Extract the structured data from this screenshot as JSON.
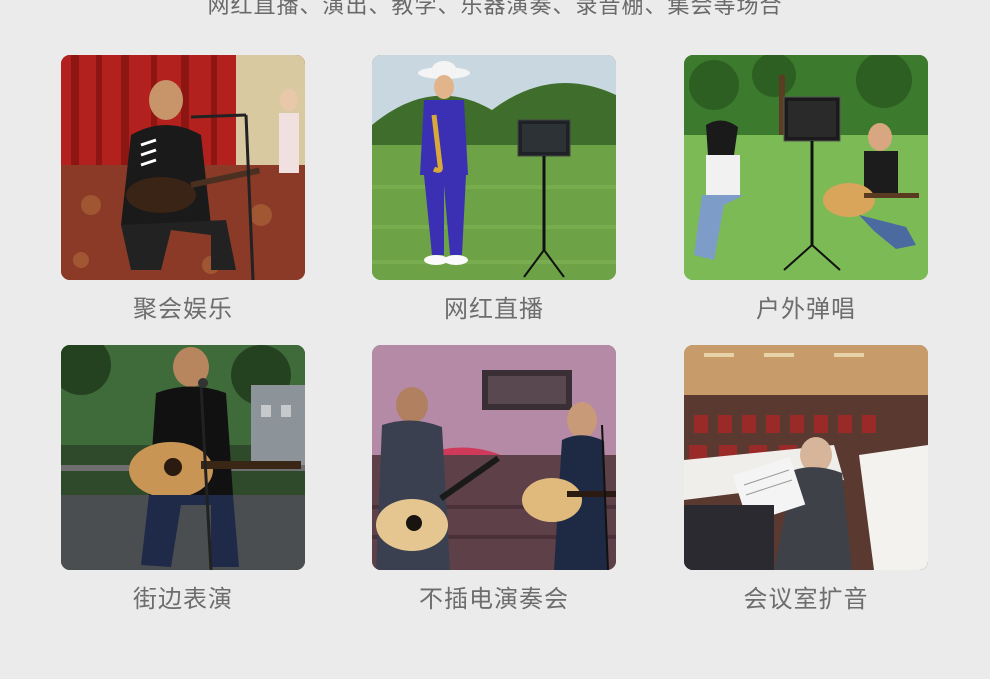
{
  "header": {
    "subtitle": "网红直播、演出、教学、乐器演奏、录音棚、集会等场合"
  },
  "scenarios": [
    {
      "label": "聚会娱乐"
    },
    {
      "label": "网红直播"
    },
    {
      "label": "户外弹唱"
    },
    {
      "label": "街边表演"
    },
    {
      "label": "不插电演奏会"
    },
    {
      "label": "会议室扩音"
    }
  ]
}
